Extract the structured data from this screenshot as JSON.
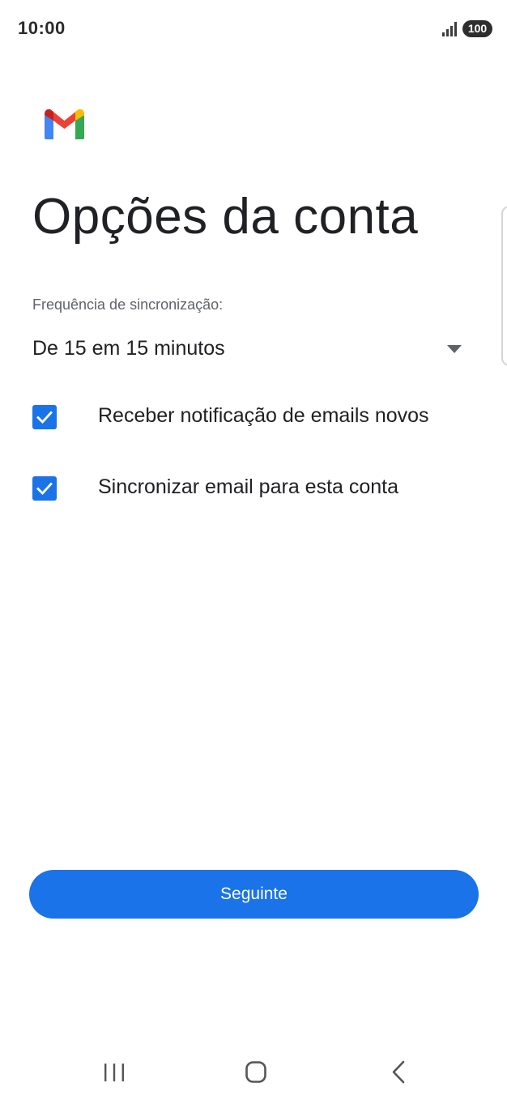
{
  "status_bar": {
    "time": "10:00",
    "battery": "100",
    "signal_icon": "signal-bars-icon"
  },
  "logo": {
    "icon": "gmail-logo",
    "colors": {
      "blue": "#4285F4",
      "red": "#EA4335",
      "yellow": "#FBBC04",
      "green": "#34A853",
      "dark_red": "#C5221F"
    }
  },
  "page": {
    "title": "Opções da conta"
  },
  "sync": {
    "label": "Frequência de sincronização:",
    "selected_value": "De 15 em 15 minutos",
    "icon": "dropdown-arrow-icon"
  },
  "options": [
    {
      "label": "Receber notificação de emails novos",
      "checked": true
    },
    {
      "label": "Sincronizar email para esta conta",
      "checked": true
    }
  ],
  "actions": {
    "next_label": "Seguinte"
  },
  "nav": {
    "recent_icon": "recent-apps-icon",
    "home_icon": "home-icon",
    "back_icon": "back-icon"
  },
  "colors": {
    "accent": "#1A73E8",
    "text_primary": "#202124",
    "text_secondary": "#5F6368"
  }
}
